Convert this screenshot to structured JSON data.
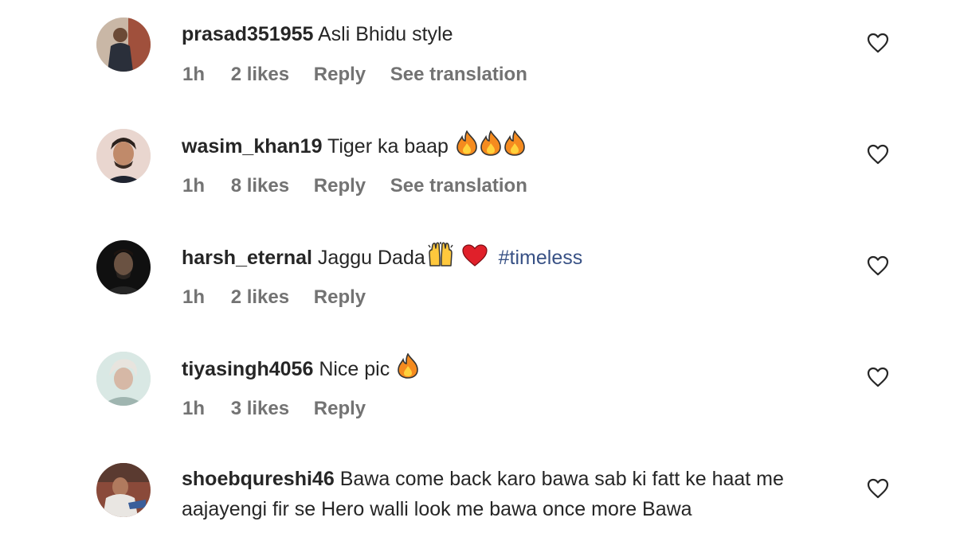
{
  "comments": [
    {
      "username": "prasad351955",
      "text": "Asli Bhidu style",
      "emojis": [],
      "hashtag": "",
      "time": "1h",
      "likes": "2 likes",
      "reply": "Reply",
      "translation": "See translation"
    },
    {
      "username": "wasim_khan19",
      "text": "Tiger ka baap",
      "emojis": [
        "fire-emoji",
        "fire-emoji",
        "fire-emoji"
      ],
      "hashtag": "",
      "time": "1h",
      "likes": "8 likes",
      "reply": "Reply",
      "translation": "See translation"
    },
    {
      "username": "harsh_eternal",
      "text": "Jaggu Dada",
      "emojis": [
        "raising-hands-emoji",
        "red-heart-emoji"
      ],
      "hashtag": "#timeless",
      "time": "1h",
      "likes": "2 likes",
      "reply": "Reply",
      "translation": ""
    },
    {
      "username": "tiyasingh4056",
      "text": "Nice pic",
      "emojis": [
        "fire-emoji"
      ],
      "hashtag": "",
      "time": "1h",
      "likes": "3 likes",
      "reply": "Reply",
      "translation": ""
    },
    {
      "username": "shoebqureshi46",
      "text": "Bawa come back karo bawa sab ki fatt ke haat me aajayengi fir se Hero walli look me bawa once more Bawa",
      "emojis": [],
      "hashtag": "",
      "time": "",
      "likes": "",
      "reply": "",
      "translation": ""
    }
  ],
  "colors": {
    "text": "#262626",
    "meta": "#737373",
    "hashtag": "#385185",
    "fire": "#f58b1f",
    "heart": "#e0202a"
  }
}
